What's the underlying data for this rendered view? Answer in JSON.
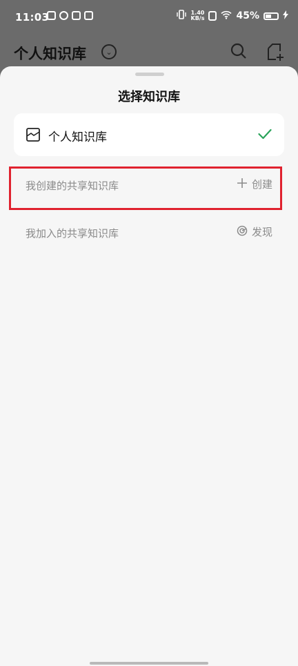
{
  "status_bar": {
    "time": "11:03",
    "speed_value": "1.40",
    "speed_unit": "KB/s",
    "battery": "45%"
  },
  "background_page": {
    "title": "个人知识库"
  },
  "sheet": {
    "title": "选择知识库",
    "selected_item": {
      "label": "个人知识库",
      "icon": "knowledge-base-icon",
      "selected": true
    },
    "sections": [
      {
        "label": "我创建的共享知识库",
        "action_label": "创建",
        "action_icon": "plus-icon"
      },
      {
        "label": "我加入的共享知识库",
        "action_label": "发现",
        "action_icon": "discover-icon"
      }
    ]
  },
  "colors": {
    "accent_check": "#2aa35a",
    "highlight_border": "#e0222f"
  }
}
